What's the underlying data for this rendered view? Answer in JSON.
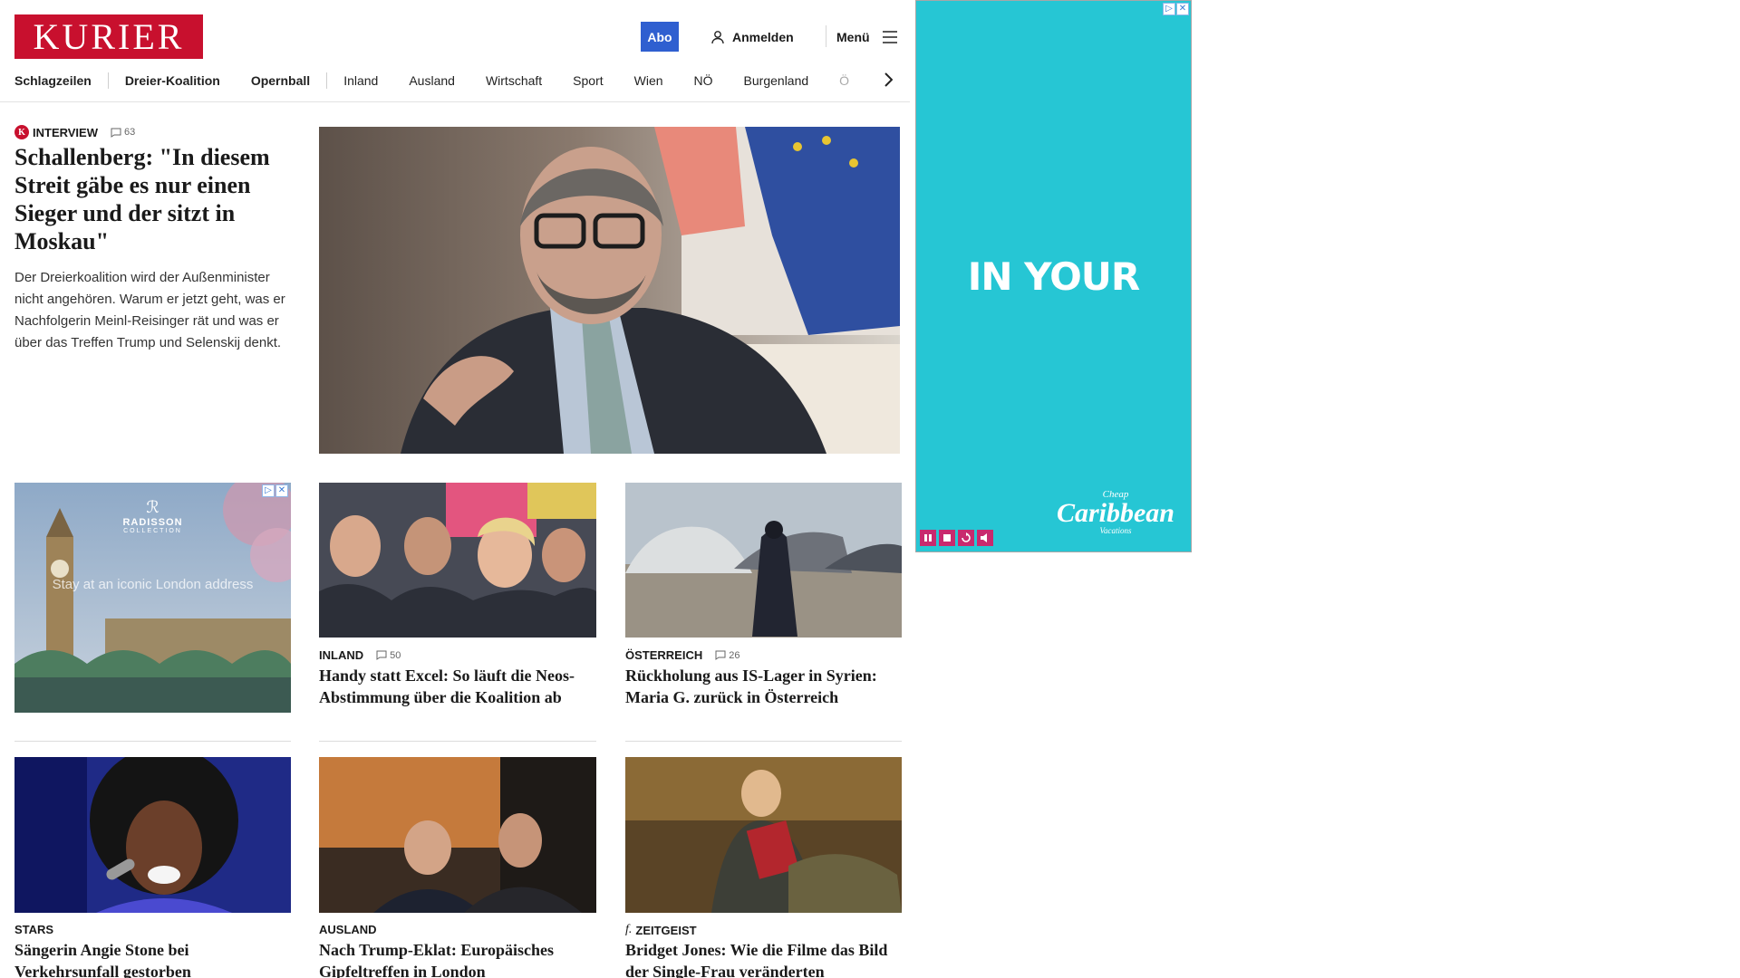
{
  "header": {
    "logo_text": "KURIER",
    "abo_label": "Abo",
    "login_label": "Anmelden",
    "menu_label": "Menü",
    "nav": [
      "Schlagzeilen",
      "Dreier-Koalition",
      "Opernball",
      "Inland",
      "Ausland",
      "Wirtschaft",
      "Sport",
      "Wien",
      "NÖ",
      "Burgenland",
      "Ö"
    ]
  },
  "lead": {
    "kicker": "INTERVIEW",
    "comments": "63",
    "badge": "K",
    "title": "Schallenberg: \"In diesem Streit gäbe es nur einen Sieger und der sitzt in Moskau\"",
    "text": "Der Dreierkoalition wird der Außenminister nicht angehören. Warum er jetzt geht, was er Nachfolgerin Meinl-Reisinger rät und was er über das Treffen Trump und Selenskij denkt."
  },
  "ad_card": {
    "brand": "RADISSON",
    "brand_sub": "COLLECTION",
    "tagline": "Stay at an iconic London address"
  },
  "cards": [
    {
      "kicker": "INLAND",
      "comments": "50",
      "title": "Handy statt Excel: So läuft die Neos-Abstimmung über die Koalition ab"
    },
    {
      "kicker": "ÖSTERREICH",
      "comments": "26",
      "title": "Rückholung aus IS-Lager in Syrien: Maria G. zurück in Österreich"
    },
    {
      "kicker": "STARS",
      "title": "Sängerin Angie Stone bei Verkehrsunfall gestorben"
    },
    {
      "kicker": "AUSLAND",
      "title": "Nach Trump-Eklat: Europäisches Gipfeltreffen in London"
    },
    {
      "kicker": "ZEITGEIST",
      "title": "Bridget Jones: Wie die Filme das Bild der Single-Frau veränderten"
    }
  ],
  "side_ad": {
    "headline": "IN YOUR",
    "brand_top": "Cheap",
    "brand_main": "Caribbean",
    "brand_bottom": "Vacations"
  },
  "colors": {
    "brand_red": "#c8102e",
    "abo_blue": "#2f5fd0",
    "ad_cyan": "#26c6d4",
    "ad_controls": "#c8296e"
  }
}
